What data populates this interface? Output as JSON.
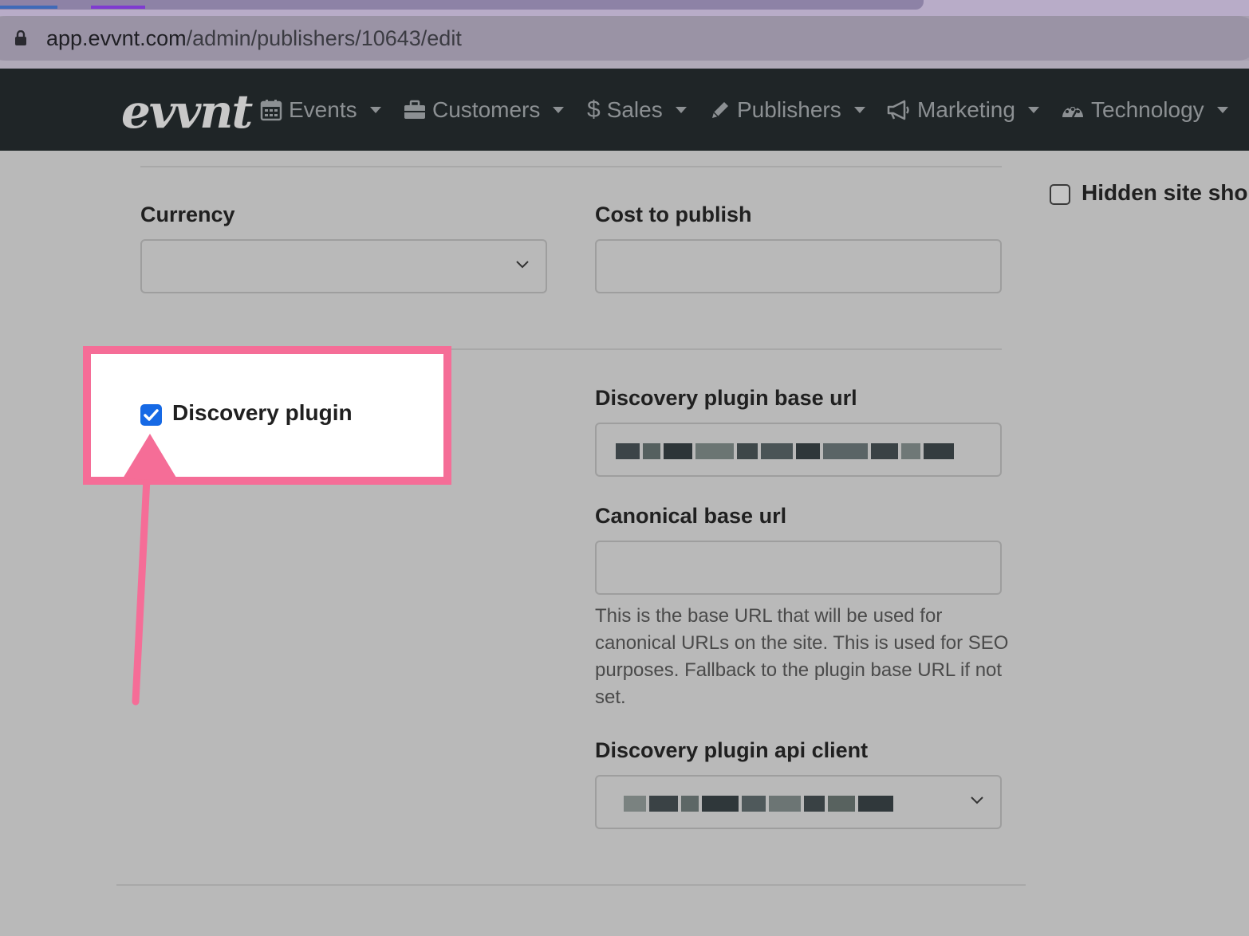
{
  "browser": {
    "url_host": "app.evvnt.com",
    "url_path": "/admin/publishers/10643/edit"
  },
  "navbar": {
    "brand": "evvnt",
    "items": [
      {
        "label": "Events",
        "icon": "calendar-icon"
      },
      {
        "label": "Customers",
        "icon": "briefcase-icon"
      },
      {
        "label": "Sales",
        "icon": "dollar-icon"
      },
      {
        "label": "Publishers",
        "icon": "pencil-icon"
      },
      {
        "label": "Marketing",
        "icon": "bullhorn-icon"
      },
      {
        "label": "Technology",
        "icon": "dashboard-icon"
      }
    ]
  },
  "form": {
    "currency": {
      "label": "Currency",
      "value": ""
    },
    "cost_to_publish": {
      "label": "Cost to publish",
      "value": ""
    },
    "hidden_site": {
      "label": "Hidden site sho",
      "checked": false
    },
    "discovery_plugin": {
      "label": "Discovery plugin",
      "checked": true
    },
    "discovery_plugin_base_url": {
      "label": "Discovery plugin base url"
    },
    "canonical_base_url": {
      "label": "Canonical base url",
      "value": "",
      "help": "This is the base URL that will be used for canonical URLs on the site. This is used for SEO purposes. Fallback to the plugin base URL if not set."
    },
    "discovery_plugin_api_client": {
      "label": "Discovery plugin api client"
    }
  },
  "colors": {
    "highlight": "#f56d97",
    "checkbox_checked": "#1669e5",
    "navbar_bg": "#1f2527"
  }
}
